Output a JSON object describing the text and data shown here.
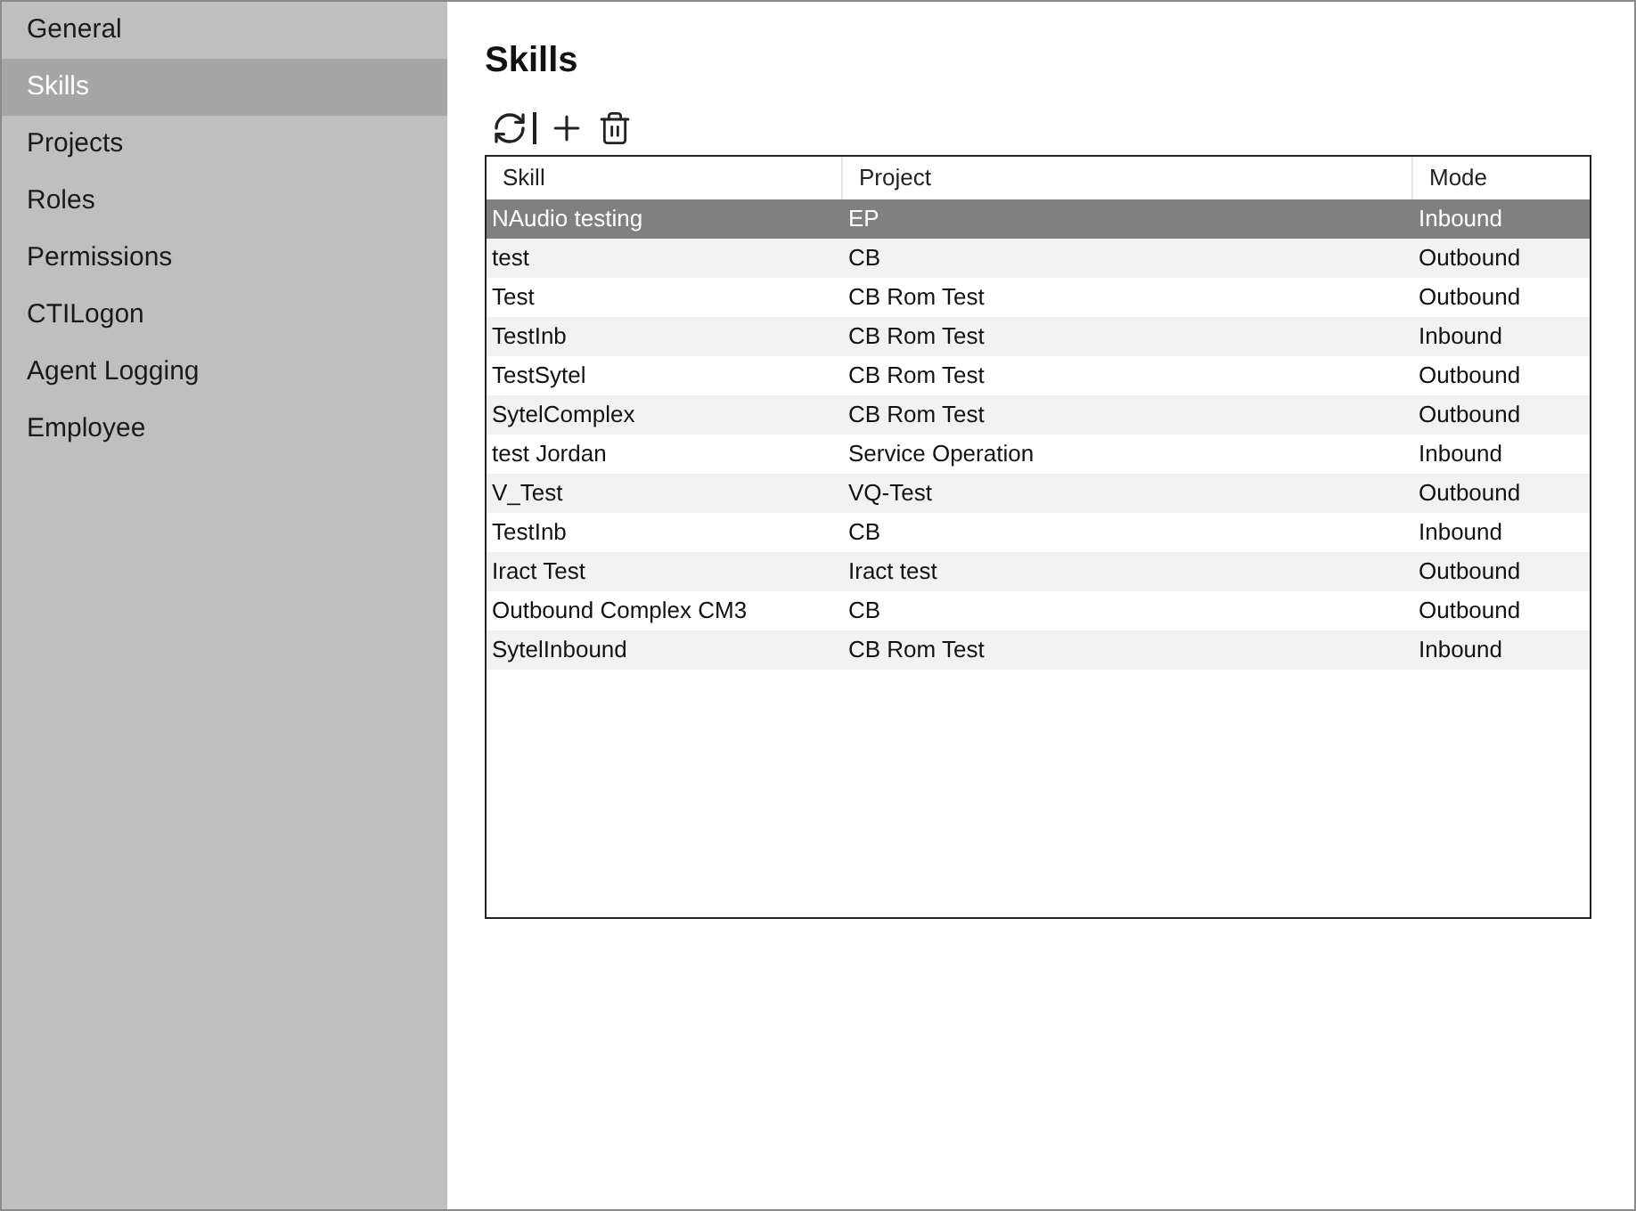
{
  "sidebar": {
    "items": [
      {
        "label": "General",
        "selected": false
      },
      {
        "label": "Skills",
        "selected": true
      },
      {
        "label": "Projects",
        "selected": false
      },
      {
        "label": "Roles",
        "selected": false
      },
      {
        "label": "Permissions",
        "selected": false
      },
      {
        "label": "CTILogon",
        "selected": false
      },
      {
        "label": "Agent Logging",
        "selected": false
      },
      {
        "label": "Employee",
        "selected": false
      }
    ]
  },
  "title": "Skills",
  "table": {
    "columns": [
      "Skill",
      "Project",
      "Mode"
    ],
    "rows": [
      {
        "cells": [
          "NAudio testing",
          "EP",
          "Inbound"
        ],
        "selected": true
      },
      {
        "cells": [
          "test",
          "CB",
          "Outbound"
        ],
        "selected": false
      },
      {
        "cells": [
          "Test",
          "CB Rom Test",
          "Outbound"
        ],
        "selected": false
      },
      {
        "cells": [
          "TestInb",
          "CB Rom Test",
          "Inbound"
        ],
        "selected": false
      },
      {
        "cells": [
          "TestSytel",
          "CB Rom Test",
          "Outbound"
        ],
        "selected": false
      },
      {
        "cells": [
          "SytelComplex",
          "CB Rom Test",
          "Outbound"
        ],
        "selected": false
      },
      {
        "cells": [
          "test Jordan",
          "Service Operation",
          "Inbound"
        ],
        "selected": false
      },
      {
        "cells": [
          "V_Test",
          "VQ-Test",
          "Outbound"
        ],
        "selected": false
      },
      {
        "cells": [
          "TestInb",
          "CB",
          "Inbound"
        ],
        "selected": false
      },
      {
        "cells": [
          "Iract Test",
          "Iract test",
          "Outbound"
        ],
        "selected": false
      },
      {
        "cells": [
          "Outbound Complex CM3",
          "CB",
          "Outbound"
        ],
        "selected": false
      },
      {
        "cells": [
          "SytelInbound",
          "CB Rom Test",
          "Inbound"
        ],
        "selected": false
      }
    ]
  }
}
